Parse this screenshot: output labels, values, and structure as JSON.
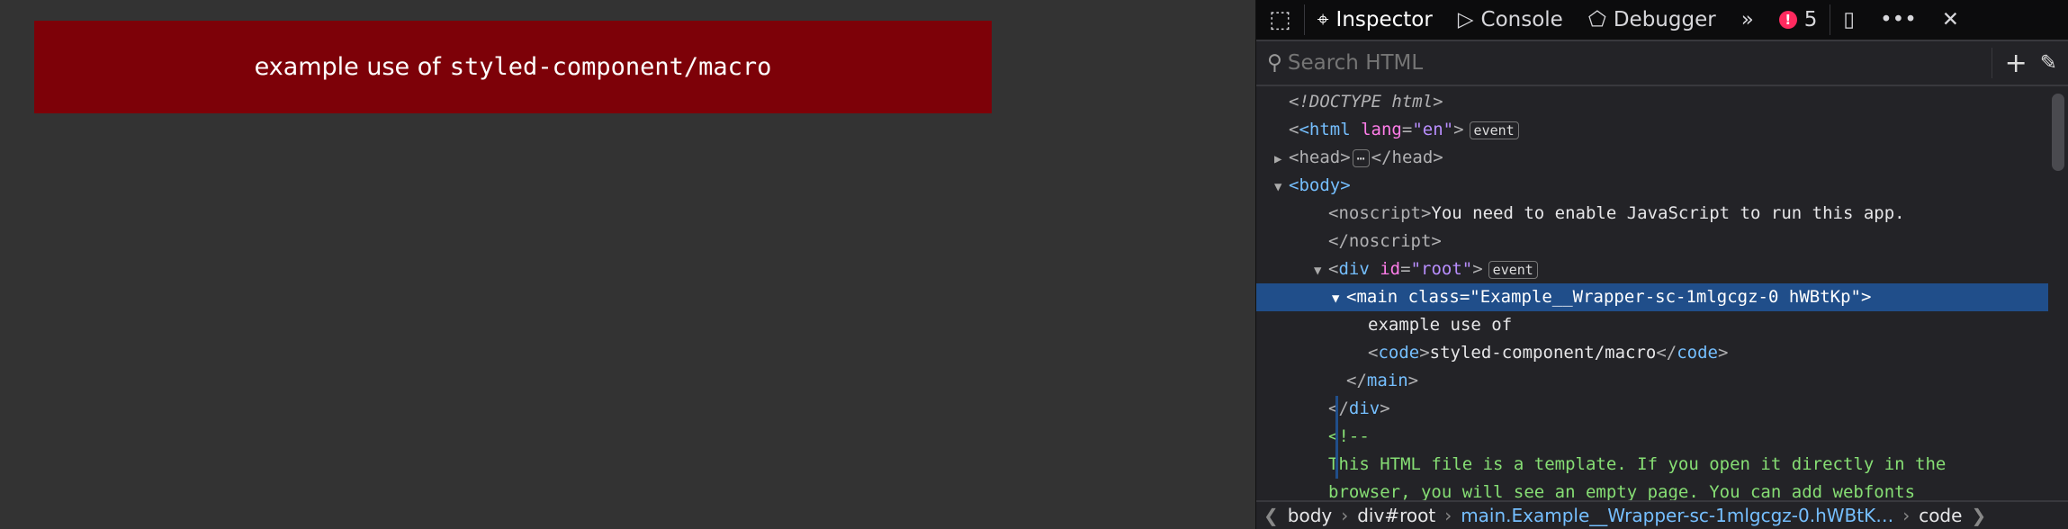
{
  "page": {
    "banner_text": "example use of",
    "banner_code": "styled-component/macro",
    "banner_color": "#7d0108"
  },
  "toolbar": {
    "picker_icon": "element-picker-icon",
    "tabs": [
      {
        "label": "Inspector",
        "icon": "inspector-icon",
        "selected": true
      },
      {
        "label": "Console",
        "icon": "console-icon"
      },
      {
        "label": "Debugger",
        "icon": "debugger-icon"
      }
    ],
    "more_tabs_icon": "chevrons-right-icon",
    "error_count": "5",
    "responsive_icon": "responsive-mode-icon",
    "menu_icon": "ellipsis-icon",
    "close_icon": "close-icon"
  },
  "search": {
    "placeholder": "Search HTML",
    "add_icon": "plus-icon",
    "eyedropper_icon": "eyedropper-icon"
  },
  "tree": {
    "doctype": "<!DOCTYPE html>",
    "html_open": "<html",
    "lang_attr": "lang",
    "lang_val": "\"en\"",
    "event": "event",
    "head": "<head>",
    "head_close": "</head>",
    "ellipsis": "⋯",
    "body": "<body>",
    "noscript_open": "<noscript>",
    "noscript_text": "You need to enable JavaScript to run this app.",
    "noscript_close": "</noscript>",
    "div_id": "id",
    "div_val": "\"root\"",
    "main_line": "<main class=\"Example__Wrapper-sc-1mlgcgz-0 hWBtKp\">",
    "text_line": "example use of",
    "code_text": "styled-component/macro",
    "main_close": "main",
    "div_close": "div",
    "comment_open": "<!--",
    "comment_1": "This HTML file is a template. If you open it directly in the",
    "comment_2": "browser, you will see an empty page. You can add webfonts"
  },
  "breadcrumbs": [
    "body",
    "div#root",
    "main.Example__Wrapper-sc-1mlgcgz-0.hWBtK…",
    "code"
  ]
}
